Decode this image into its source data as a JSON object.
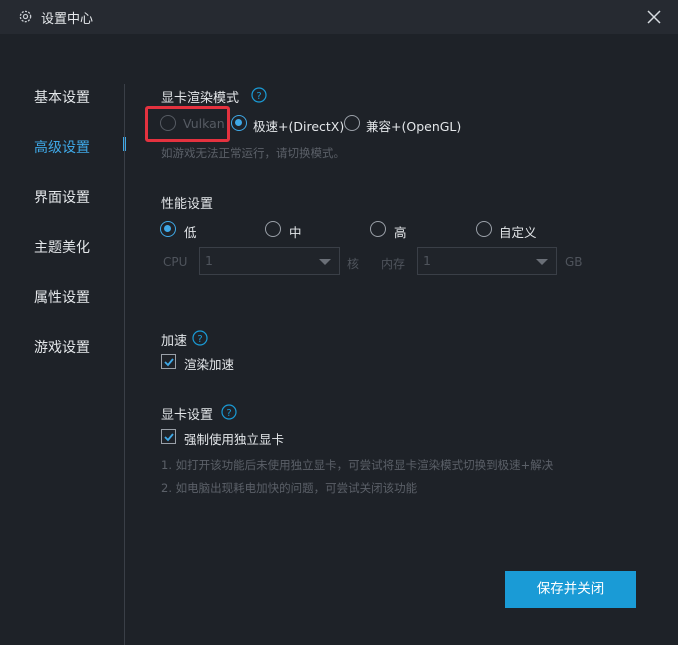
{
  "window": {
    "title": "设置中心",
    "settings_icon": "gear-icon",
    "close_icon": "close-icon"
  },
  "sidebar": {
    "items": [
      {
        "label": "基本设置",
        "active": false
      },
      {
        "label": "高级设置",
        "active": true
      },
      {
        "label": "界面设置",
        "active": false
      },
      {
        "label": "主题美化",
        "active": false
      },
      {
        "label": "属性设置",
        "active": false
      },
      {
        "label": "游戏设置",
        "active": false
      }
    ]
  },
  "render_mode": {
    "title": "显卡渲染模式",
    "help_icon": "question-circle-icon",
    "options": [
      {
        "label": "Vulkan",
        "checked": false,
        "disabled": true
      },
      {
        "label": "极速+(DirectX)",
        "checked": true,
        "disabled": false
      },
      {
        "label": "兼容+(OpenGL)",
        "checked": false,
        "disabled": false
      }
    ],
    "hint": "如游戏无法正常运行，请切换模式。"
  },
  "performance": {
    "title": "性能设置",
    "options": [
      {
        "label": "低",
        "checked": true
      },
      {
        "label": "中",
        "checked": false
      },
      {
        "label": "高",
        "checked": false
      },
      {
        "label": "自定义",
        "checked": false
      }
    ],
    "cpu_label": "CPU",
    "cpu_value": "1",
    "cpu_unit": "核",
    "memory_label": "内存",
    "memory_value": "1",
    "memory_unit": "GB"
  },
  "acceleration": {
    "title": "加速",
    "help_icon": "question-circle-icon",
    "checkbox_label": "渲染加速",
    "checked": true
  },
  "gpu": {
    "title": "显卡设置",
    "help_icon": "question-circle-icon",
    "checkbox_label": "强制使用独立显卡",
    "checked": true,
    "notes": [
      "1. 如打开该功能后未使用独立显卡，可尝试将显卡渲染模式切换到极速+解决",
      "2. 如电脑出现耗电加快的问题，可尝试关闭该功能"
    ]
  },
  "footer": {
    "save_close_label": "保存并关闭"
  },
  "colors": {
    "accent": "#1a9bd6",
    "highlight": "#e4323f",
    "background": "#1e2228"
  }
}
